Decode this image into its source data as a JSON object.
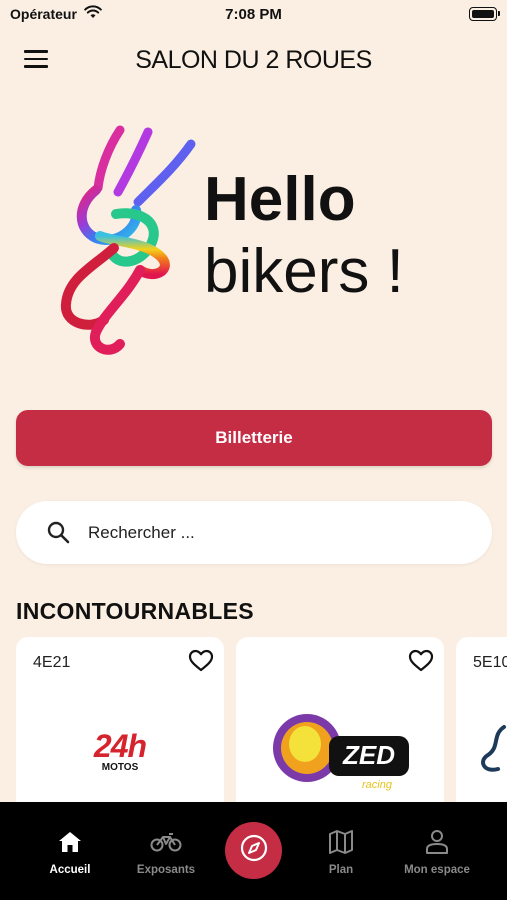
{
  "status_bar": {
    "carrier": "Opérateur",
    "time": "7:08 PM"
  },
  "header": {
    "title": "SALON DU 2 ROUES"
  },
  "hero": {
    "line1": "Hello",
    "line2": "bikers !"
  },
  "ticket_button": {
    "label": "Billetterie"
  },
  "search": {
    "placeholder": "Rechercher ..."
  },
  "section": {
    "title": "INCONTOURNABLES"
  },
  "cards": [
    {
      "code": "4E21",
      "logo": "24h-motos-logo",
      "logo_text_main": "24h",
      "logo_text_sub": "MOTOS"
    },
    {
      "code": "",
      "logo": "zed-racing-logo",
      "logo_text_main": "ZED",
      "logo_text_sub": "racing"
    },
    {
      "code": "5E10",
      "logo": "partial-logo"
    }
  ],
  "tabbar": {
    "items": [
      {
        "label": "Accueil",
        "icon": "home-icon",
        "active": true
      },
      {
        "label": "Exposants",
        "icon": "motorcycle-icon",
        "active": false
      },
      {
        "label": "Plan",
        "icon": "map-icon",
        "active": false
      },
      {
        "label": "Mon espace",
        "icon": "user-icon",
        "active": false
      }
    ],
    "center_icon": "compass-icon"
  },
  "colors": {
    "background": "#fbefe3",
    "accent": "#c42d44",
    "tabbar": "#000000"
  }
}
